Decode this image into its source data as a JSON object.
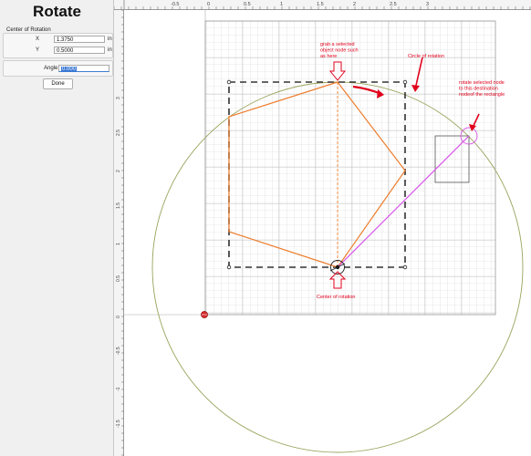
{
  "panel": {
    "title": "Rotate",
    "center_group_label": "Center of Rotation",
    "x_label": "X",
    "x_value": "1.3750",
    "y_label": "Y",
    "y_value": "0.5000",
    "unit": "in",
    "angle_label": "Angle",
    "angle_value": "0.000",
    "done_label": "Done"
  },
  "rulers": {
    "top_ticks": [
      "-0.5",
      "0",
      "0.5",
      "1",
      "1.5",
      "2",
      "2.5",
      "3"
    ],
    "left_ticks": [
      "3",
      "2.5",
      "2",
      "1.5",
      "1",
      "0.5",
      "0",
      "-0.5",
      "-1",
      "-1.5"
    ]
  },
  "annotations": {
    "grab_node": "grab a selected object node such as here",
    "circle_of_rotation": "Circle of rotation",
    "rotate_destination": "rotate selected node to this destination nodeof the rectangle",
    "center_of_rotation": "Center of rotation"
  },
  "colors": {
    "annotation": "#e0001b",
    "polygon": "#ee7d2d",
    "circle": "#9aa35c",
    "magenta": "#d855e8"
  }
}
